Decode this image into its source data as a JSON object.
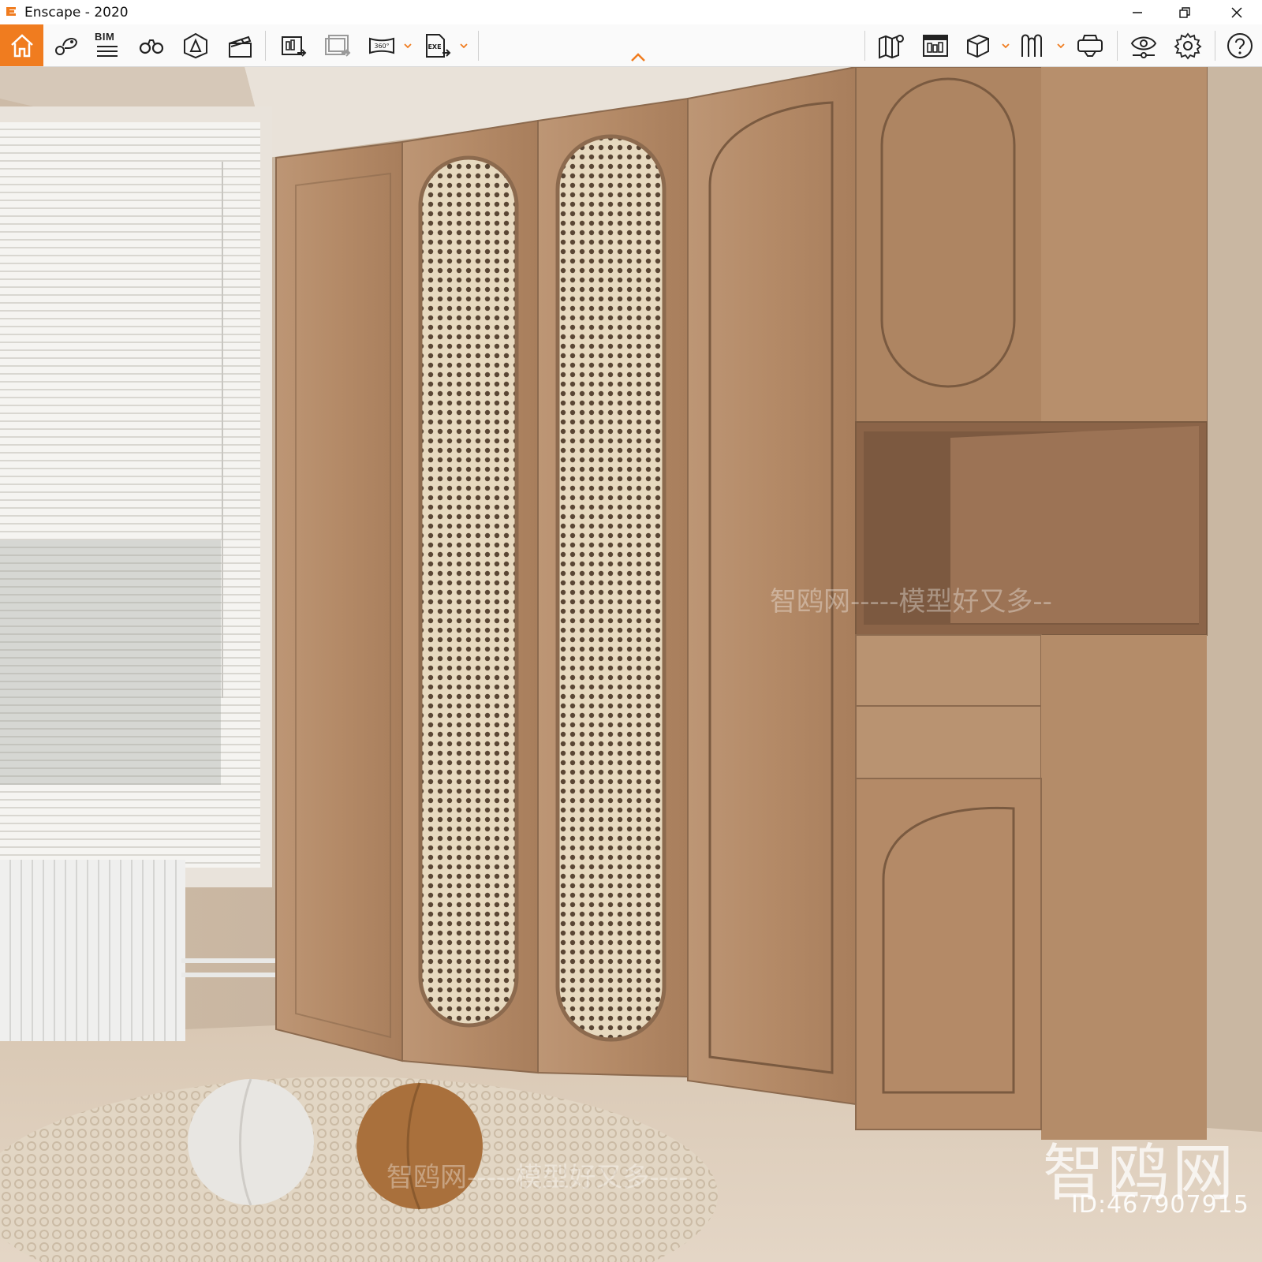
{
  "window": {
    "title": "Enscape - 2020",
    "brand_color": "#f07c1f",
    "controls": [
      "minimize-icon",
      "restore-icon",
      "close-icon"
    ]
  },
  "toolbar": {
    "home_icon": "home-icon",
    "left_tools": [
      {
        "name": "views-icon"
      },
      {
        "name": "bim-icon",
        "label": "BIM"
      },
      {
        "name": "binoculars-icon"
      },
      {
        "name": "atmosphere-icon"
      },
      {
        "name": "video-editor-icon"
      },
      {
        "name": "render-image-icon"
      },
      {
        "name": "batch-render-icon"
      },
      {
        "name": "panorama-360-icon",
        "label": "360°"
      },
      {
        "name": "export-exe-icon",
        "label": "EXE"
      }
    ],
    "right_tools": [
      {
        "name": "map-icon"
      },
      {
        "name": "asset-library-icon"
      },
      {
        "name": "cube-view-icon"
      },
      {
        "name": "material-editor-icon"
      },
      {
        "name": "vr-headset-icon"
      },
      {
        "name": "visual-settings-icon"
      },
      {
        "name": "settings-icon"
      },
      {
        "name": "help-icon"
      }
    ]
  },
  "viewport": {
    "description_scene": "wood wardrobe with rattan panels",
    "watermarks": {
      "logo_text": "智鸥网",
      "id_text": "ID:467907915",
      "center_text": "智鸥网-----模型好又多--",
      "bottom_text": "智鸥网-----模型好又多----"
    }
  }
}
